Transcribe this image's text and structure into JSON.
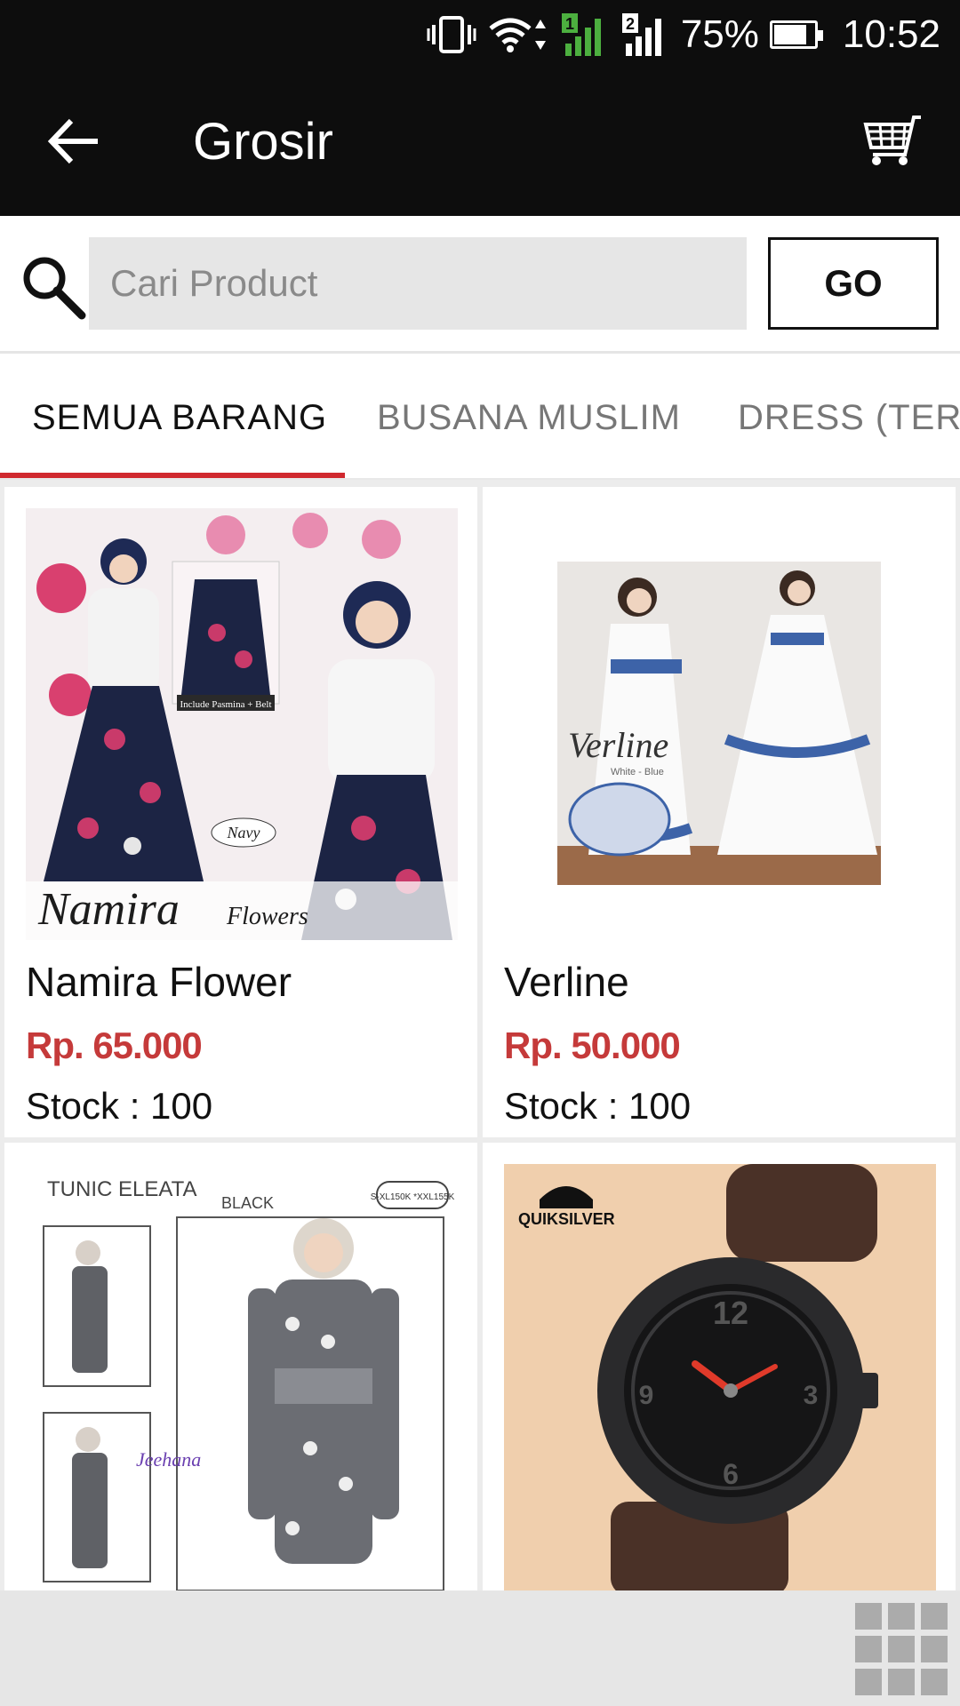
{
  "status_bar": {
    "battery_percent": "75%",
    "time": "10:52",
    "battery_level": 0.75,
    "icons": [
      "vibrate-icon",
      "wifi-icon",
      "sim1-signal-icon",
      "sim2-signal-icon",
      "battery-icon"
    ]
  },
  "app_bar": {
    "title": "Grosir",
    "back_icon": "arrow-left-icon",
    "cart_icon": "shopping-cart-icon"
  },
  "search": {
    "placeholder": "Cari Product",
    "value": "",
    "go_label": "GO",
    "icon": "search-icon"
  },
  "tabs": [
    {
      "label": "SEMUA BARANG",
      "active": true
    },
    {
      "label": "BUSANA MUSLIM",
      "active": false
    },
    {
      "label": "DRESS (TERU",
      "active": false
    }
  ],
  "products": [
    {
      "name": "Namira Flower",
      "price": "Rp. 65.000",
      "stock": "Stock : 100",
      "image_text": "Namira",
      "image_subtext": "Flowers",
      "image_badge": "Navy",
      "image_label": "Include Pasmina + Belt"
    },
    {
      "name": "Verline",
      "price": "Rp. 50.000",
      "stock": "Stock : 100",
      "image_text": "Verline",
      "image_subtext": "White - Blue"
    },
    {
      "name": "",
      "price": "",
      "stock": "",
      "image_text": "TUNIC ELEATA",
      "image_subtext": "BLACK",
      "image_badge": "S-XL150K *XXL155K",
      "image_label": "Jeehana"
    },
    {
      "name": "",
      "price": "",
      "stock": "",
      "image_text": "QUIKSILVER"
    }
  ],
  "colors": {
    "app_bar": "#0d0d0d",
    "accent": "#d0282e",
    "price": "#c53a3a",
    "input_bg": "#e6e6e6"
  },
  "bottom_bar": {
    "grid_icon": "grid-view-icon"
  }
}
